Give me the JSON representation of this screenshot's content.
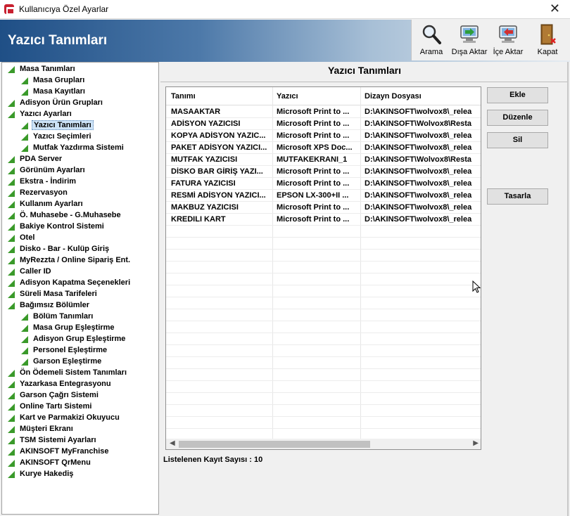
{
  "window": {
    "title": "Kullanıcıya Özel Ayarlar",
    "close": "✕"
  },
  "banner": {
    "title": "Yazıcı Tanımları"
  },
  "toolbar": {
    "arama": "Arama",
    "disa_aktar": "Dışa Aktar",
    "ice_aktar": "İçe Aktar",
    "kapat": "Kapat"
  },
  "tree": {
    "items": [
      {
        "label": "Masa Tanımları",
        "level": 0
      },
      {
        "label": "Masa Grupları",
        "level": 1
      },
      {
        "label": "Masa Kayıtları",
        "level": 1
      },
      {
        "label": "Adisyon Ürün Grupları",
        "level": 0
      },
      {
        "label": "Yazıcı Ayarları",
        "level": 0
      },
      {
        "label": "Yazıcı Tanımları",
        "level": 1,
        "selected": true
      },
      {
        "label": "Yazıcı Seçimleri",
        "level": 1
      },
      {
        "label": "Mutfak Yazdırma Sistemi",
        "level": 1
      },
      {
        "label": "PDA Server",
        "level": 0
      },
      {
        "label": "Görünüm Ayarları",
        "level": 0
      },
      {
        "label": "Ekstra - İndirim",
        "level": 0
      },
      {
        "label": "Rezervasyon",
        "level": 0
      },
      {
        "label": "Kullanım Ayarları",
        "level": 0
      },
      {
        "label": "Ö. Muhasebe - G.Muhasebe",
        "level": 0
      },
      {
        "label": "Bakiye Kontrol Sistemi",
        "level": 0
      },
      {
        "label": "Otel",
        "level": 0
      },
      {
        "label": "Disko - Bar - Kulüp Giriş",
        "level": 0
      },
      {
        "label": "MyRezzta / Online Sipariş Ent.",
        "level": 0
      },
      {
        "label": "Caller ID",
        "level": 0
      },
      {
        "label": "Adisyon Kapatma Seçenekleri",
        "level": 0
      },
      {
        "label": "Süreli Masa Tarifeleri",
        "level": 0
      },
      {
        "label": "Bağımsız Bölümler",
        "level": 0
      },
      {
        "label": "Bölüm Tanımları",
        "level": 1
      },
      {
        "label": "Masa Grup Eşleştirme",
        "level": 1
      },
      {
        "label": "Adisyon Grup Eşleştirme",
        "level": 1
      },
      {
        "label": "Personel Eşleştirme",
        "level": 1
      },
      {
        "label": "Garson Eşleştirme",
        "level": 1
      },
      {
        "label": "Ön Ödemeli Sistem Tanımları",
        "level": 0
      },
      {
        "label": "Yazarkasa Entegrasyonu",
        "level": 0
      },
      {
        "label": "Garson Çağrı Sistemi",
        "level": 0
      },
      {
        "label": "Online Tartı Sistemi",
        "level": 0
      },
      {
        "label": "Kart ve Parmakizi Okuyucu",
        "level": 0
      },
      {
        "label": "Müşteri Ekranı",
        "level": 0
      },
      {
        "label": "TSM Sistemi Ayarları",
        "level": 0
      },
      {
        "label": "AKINSOFT MyFranchise",
        "level": 0
      },
      {
        "label": "AKINSOFT QrMenu",
        "level": 0
      },
      {
        "label": "Kurye Hakediş",
        "level": 0
      }
    ]
  },
  "panel": {
    "title": "Yazıcı Tanımları"
  },
  "grid": {
    "columns": [
      "Tanımı",
      "Yazıcı",
      "Dizayn Dosyası"
    ],
    "rows": [
      [
        "MASAAKTAR",
        "Microsoft Print to ...",
        "D:\\AKINSOFT\\wolvox8\\_relea"
      ],
      [
        "ADİSYON YAZICISI",
        "Microsoft Print to ...",
        "D:\\AKINSOFT\\Wolvox8\\Resta"
      ],
      [
        "KOPYA ADİSYON YAZIC...",
        "Microsoft Print to ...",
        "D:\\AKINSOFT\\wolvox8\\_relea"
      ],
      [
        "PAKET ADİSYON YAZICI...",
        "Microsoft XPS Doc...",
        "D:\\AKINSOFT\\wolvox8\\_relea"
      ],
      [
        "MUTFAK YAZICISI",
        "MUTFAKEKRANI_1",
        "D:\\AKINSOFT\\Wolvox8\\Resta"
      ],
      [
        "DİSKO BAR GİRİŞ YAZI...",
        "Microsoft Print to ...",
        "D:\\AKINSOFT\\wolvox8\\_relea"
      ],
      [
        "FATURA YAZICISI",
        "Microsoft Print to ...",
        "D:\\AKINSOFT\\wolvox8\\_relea"
      ],
      [
        "RESMİ ADİSYON YAZICI...",
        "EPSON LX-300+II ...",
        "D:\\AKINSOFT\\wolvox8\\_relea"
      ],
      [
        "MAKBUZ YAZICISI",
        "Microsoft Print to ...",
        "D:\\AKINSOFT\\wolvox8\\_relea"
      ],
      [
        "KREDILI KART",
        "Microsoft Print to ...",
        "D:\\AKINSOFT\\wolvox8\\_relea"
      ]
    ]
  },
  "buttons": {
    "ekle": "Ekle",
    "duzenle": "Düzenle",
    "sil": "Sil",
    "tasarla": "Tasarla"
  },
  "status": {
    "text": "Listelenen Kayıt Sayısı : 10"
  }
}
